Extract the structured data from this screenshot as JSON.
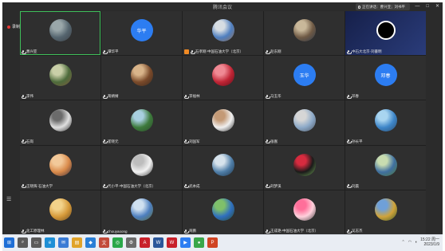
{
  "window": {
    "title": "腾讯会议",
    "recording_label": "录制中",
    "minimize": "—",
    "maximize": "□",
    "close": "✕"
  },
  "speaking": {
    "label": "正在讲话：曹兴亚；刘书平"
  },
  "tiles": [
    {
      "name": "曹兴亚",
      "kind": "photo",
      "palette": [
        "#55656f",
        "#9aa7aa",
        "#3c4046"
      ],
      "host": false,
      "active": true
    },
    {
      "name": "谭华平",
      "kind": "text",
      "avatar_text": "华平",
      "host": false
    },
    {
      "name": "石孝刚·中国石油大学（北京）",
      "kind": "photo",
      "palette": [
        "#4f7fc0",
        "#d7dde2",
        "#8f6d55"
      ],
      "host": true
    },
    {
      "name": "赵东刚",
      "kind": "photo",
      "palette": [
        "#6f5a45",
        "#c9b89a",
        "#2f3b4a"
      ],
      "host": false
    },
    {
      "name": "中石大北京-刘書明",
      "kind": "screen",
      "host": false
    },
    {
      "name": "李伟",
      "kind": "photo",
      "palette": [
        "#4d6b3b",
        "#c9cfa8",
        "#7b5a3e"
      ],
      "host": false
    },
    {
      "name": "蒋婧婧",
      "kind": "photo",
      "palette": [
        "#7a4a2a",
        "#d8b48a",
        "#3b2a1f"
      ],
      "host": false
    },
    {
      "name": "李福林",
      "kind": "photo",
      "palette": [
        "#c02535",
        "#ef8a94",
        "#5c0d18"
      ],
      "host": false
    },
    {
      "name": "马玉华",
      "kind": "text",
      "avatar_text": "玉华",
      "host": false
    },
    {
      "name": "邓春",
      "kind": "text",
      "avatar_text": "邓春",
      "host": false
    },
    {
      "name": "石岗",
      "kind": "photo",
      "palette": [
        "#e0e0e0",
        "#6b6b6b",
        "#2c2c2c"
      ],
      "host": false
    },
    {
      "name": "崔晓元",
      "kind": "photo",
      "palette": [
        "#3d7a3b",
        "#a8cfe0",
        "#2a4a2a"
      ],
      "host": false
    },
    {
      "name": "刘国军",
      "kind": "photo",
      "palette": [
        "#f0f0f0",
        "#c49a76",
        "#2a2a2a"
      ],
      "host": false
    },
    {
      "name": "张嵩",
      "kind": "photo",
      "palette": [
        "#8ca9c8",
        "#d6d6d6",
        "#4d5560"
      ],
      "host": false
    },
    {
      "name": "孙长平",
      "kind": "photo",
      "palette": [
        "#3e86c9",
        "#a9d5f0",
        "#2d4b6a"
      ],
      "host": false
    },
    {
      "name": "王晓辉·石油大学",
      "kind": "photo",
      "palette": [
        "#d98a4a",
        "#f2c99a",
        "#3a2d3a"
      ],
      "host": false
    },
    {
      "name": "代小平·中国石油大学（北京）",
      "kind": "photo",
      "palette": [
        "#f2f2f2",
        "#bdbdbd",
        "#333333"
      ],
      "host": false
    },
    {
      "name": "武本成",
      "kind": "photo",
      "palette": [
        "#4f7ea8",
        "#d7e3ec",
        "#1e3347"
      ],
      "host": false
    },
    {
      "name": "刘梦溪",
      "kind": "photo",
      "palette": [
        "#1a1a1a",
        "#d72b3f",
        "#6fa356"
      ],
      "host": false
    },
    {
      "name": "刘晨",
      "kind": "photo",
      "palette": [
        "#3f6fa0",
        "#c8dcb0",
        "#4f7a3a"
      ],
      "host": false
    },
    {
      "name": "化工原理林",
      "kind": "photo",
      "palette": [
        "#d69a3a",
        "#f2d28a",
        "#6a4a1f"
      ],
      "host": false
    },
    {
      "name": "zhouyaoong",
      "kind": "photo",
      "palette": [
        "#4d7fbf",
        "#cfe0f0",
        "#5a6a3a"
      ],
      "host": false
    },
    {
      "name": "商鹏",
      "kind": "photo",
      "palette": [
        "#2f6fc0",
        "#7fc06a",
        "#2a4a2a"
      ],
      "host": false
    },
    {
      "name": "王成艳·中国石油大学（北京）",
      "kind": "photo",
      "palette": [
        "#ffd1dc",
        "#ff6f9a",
        "#3a3a3a"
      ],
      "host": false
    },
    {
      "name": "吴志杰",
      "kind": "photo",
      "palette": [
        "#d0a33a",
        "#6fa0d8",
        "#3a5a2a"
      ],
      "host": false
    }
  ],
  "taskbar": {
    "icons": [
      {
        "name": "start-icon",
        "glyph": "⊞",
        "color": "#1f6fd6"
      },
      {
        "name": "search-icon",
        "glyph": "⌕",
        "color": "#5b5b5b"
      },
      {
        "name": "task-view-icon",
        "glyph": "▭",
        "color": "#5b5b5b"
      },
      {
        "name": "edge-icon",
        "glyph": "e",
        "color": "#1e8fd6"
      },
      {
        "name": "mail-icon",
        "glyph": "✉",
        "color": "#3a7bd5"
      },
      {
        "name": "explorer-icon",
        "glyph": "▤",
        "color": "#e0a32a"
      },
      {
        "name": "photos-icon",
        "glyph": "◆",
        "color": "#2a7fd6"
      },
      {
        "name": "app-icon",
        "glyph": "文",
        "color": "#c24a3a"
      },
      {
        "name": "browser-icon",
        "glyph": "◎",
        "color": "#2aa84a"
      },
      {
        "name": "settings-icon",
        "glyph": "⚙",
        "color": "#6b6b6b"
      },
      {
        "name": "acrobat-icon",
        "glyph": "A",
        "color": "#c8202a"
      },
      {
        "name": "word-icon",
        "glyph": "W",
        "color": "#2b579a"
      },
      {
        "name": "wps-icon",
        "glyph": "W",
        "color": "#c8202a"
      },
      {
        "name": "meeting-icon",
        "glyph": "▶",
        "color": "#2c7df2"
      },
      {
        "name": "chrome-icon",
        "glyph": "●",
        "color": "#3aa74a"
      },
      {
        "name": "powerpoint-icon",
        "glyph": "P",
        "color": "#d04423"
      }
    ],
    "time": "15:22 周一",
    "date": "2023/1/9"
  }
}
